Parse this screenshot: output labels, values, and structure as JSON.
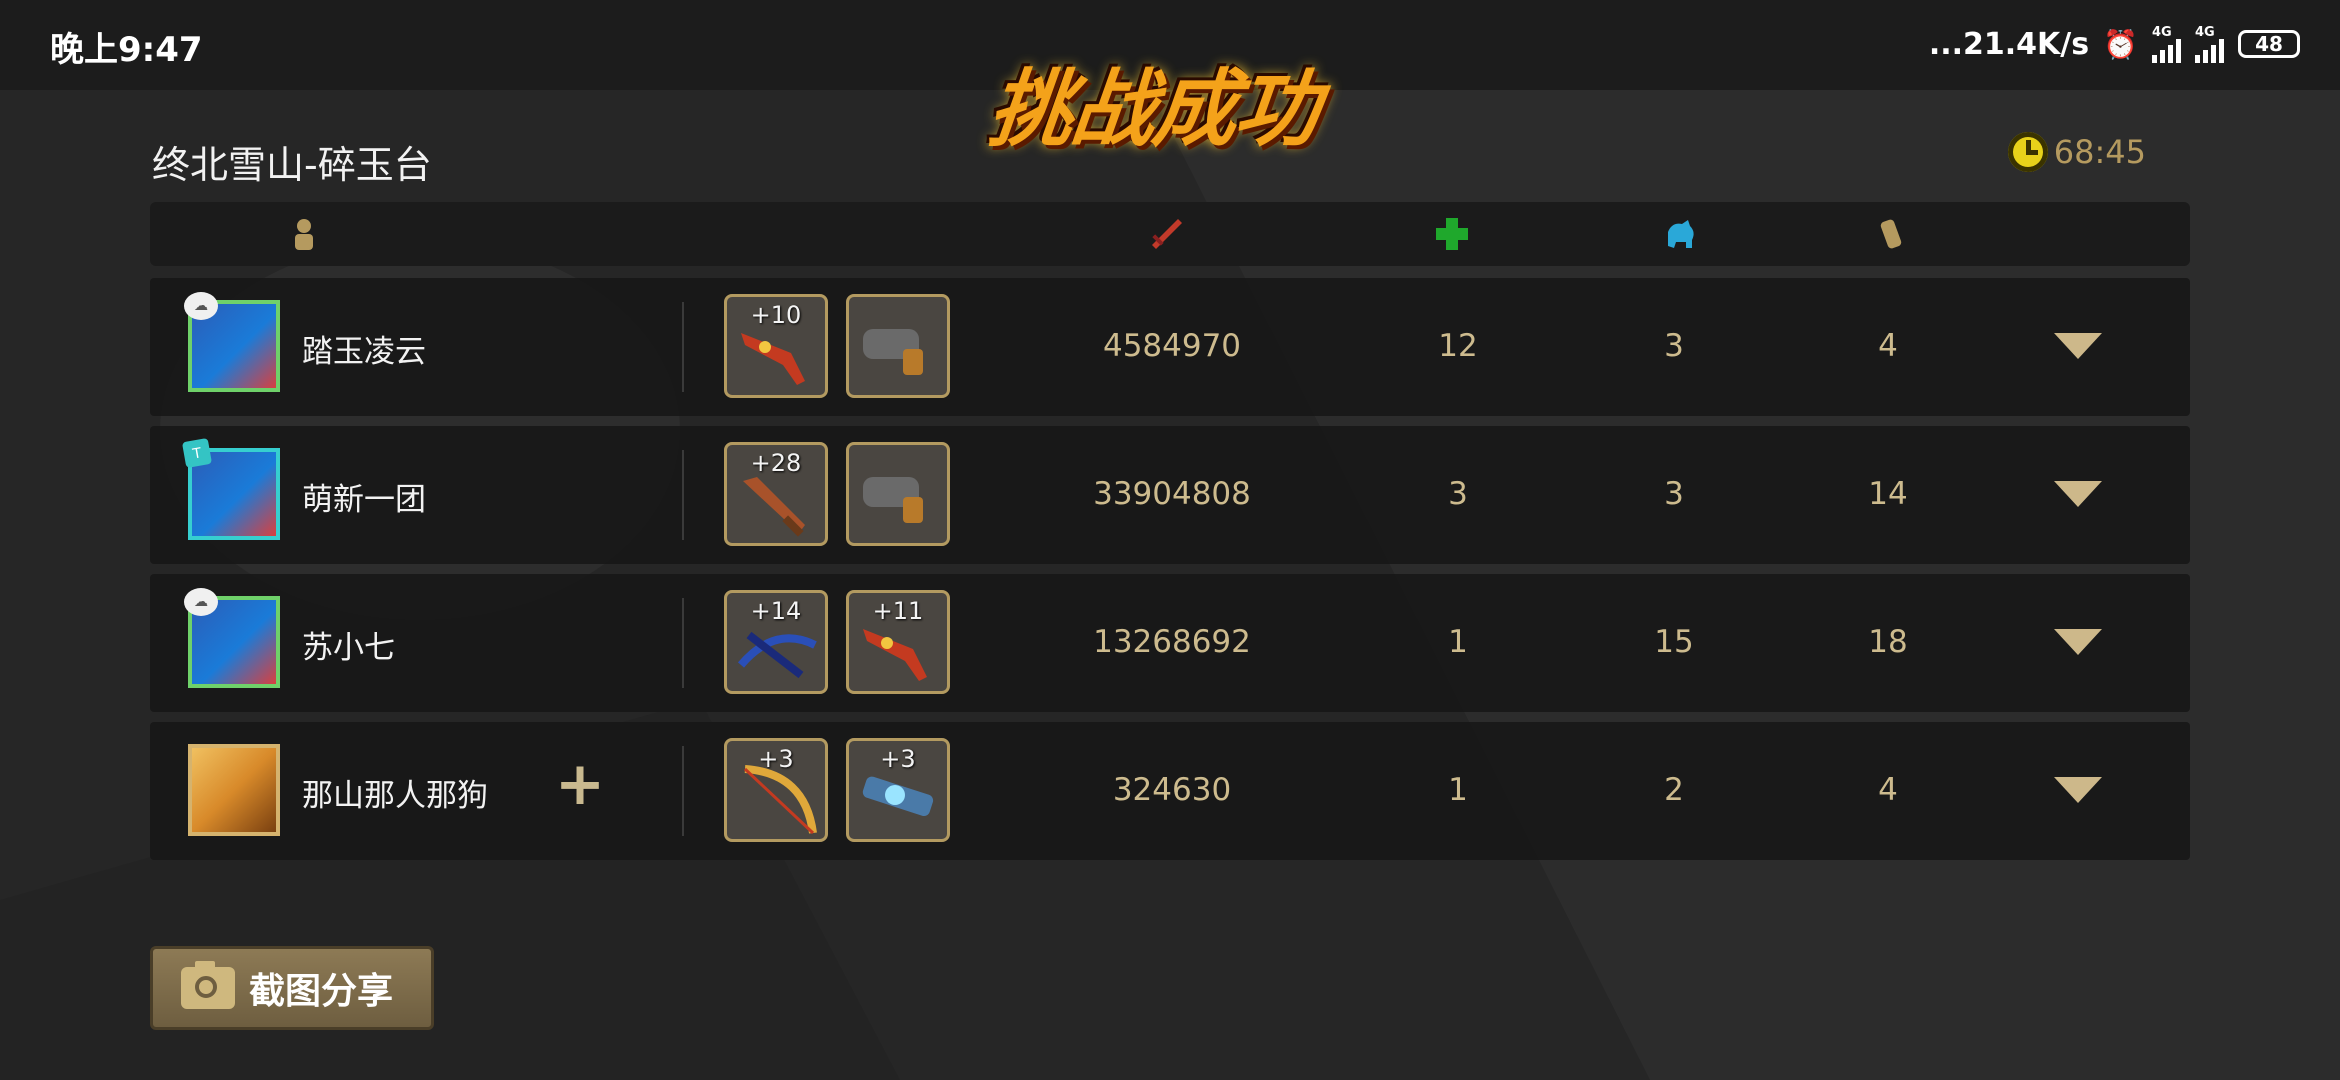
{
  "status_bar": {
    "time": "晚上9:47",
    "network_speed": "...21.4K/s",
    "signal1_label": "4G",
    "signal2_label": "4G",
    "battery": "48"
  },
  "result_title": "挑战成功",
  "stage_name": "终北雪山-碎玉台",
  "timer": "68:45",
  "table_header_icons": [
    "person-icon",
    "damage-icon",
    "heal-icon",
    "revive-icon",
    "scroll-icon"
  ],
  "players": [
    {
      "name": "踏玉凌云",
      "badge": "cloud",
      "weapons": [
        {
          "level": "+10",
          "icon": "gun-icon"
        },
        {
          "level": "",
          "icon": "cannon-icon"
        }
      ],
      "damage": "4584970",
      "heal": "12",
      "revive": "3",
      "scroll": "4"
    },
    {
      "name": "萌新一团",
      "badge": "T",
      "weapons": [
        {
          "level": "+28",
          "icon": "sword-icon"
        },
        {
          "level": "",
          "icon": "cannon-icon"
        }
      ],
      "damage": "33904808",
      "heal": "3",
      "revive": "3",
      "scroll": "14"
    },
    {
      "name": "苏小七",
      "badge": "cloud",
      "weapons": [
        {
          "level": "+14",
          "icon": "crossbow-icon"
        },
        {
          "level": "+11",
          "icon": "gun-icon"
        }
      ],
      "damage": "13268692",
      "heal": "1",
      "revive": "15",
      "scroll": "18"
    },
    {
      "name": "那山那人那狗",
      "badge": "",
      "weapons": [
        {
          "level": "+3",
          "icon": "bow-icon"
        },
        {
          "level": "+3",
          "icon": "laser-gun-icon"
        }
      ],
      "damage": "324630",
      "heal": "1",
      "revive": "2",
      "scroll": "4"
    }
  ],
  "share_button": "截图分享",
  "colors": {
    "accent": "#cdb88a",
    "title": "#f4a21a",
    "clock": "#e8d21a"
  }
}
